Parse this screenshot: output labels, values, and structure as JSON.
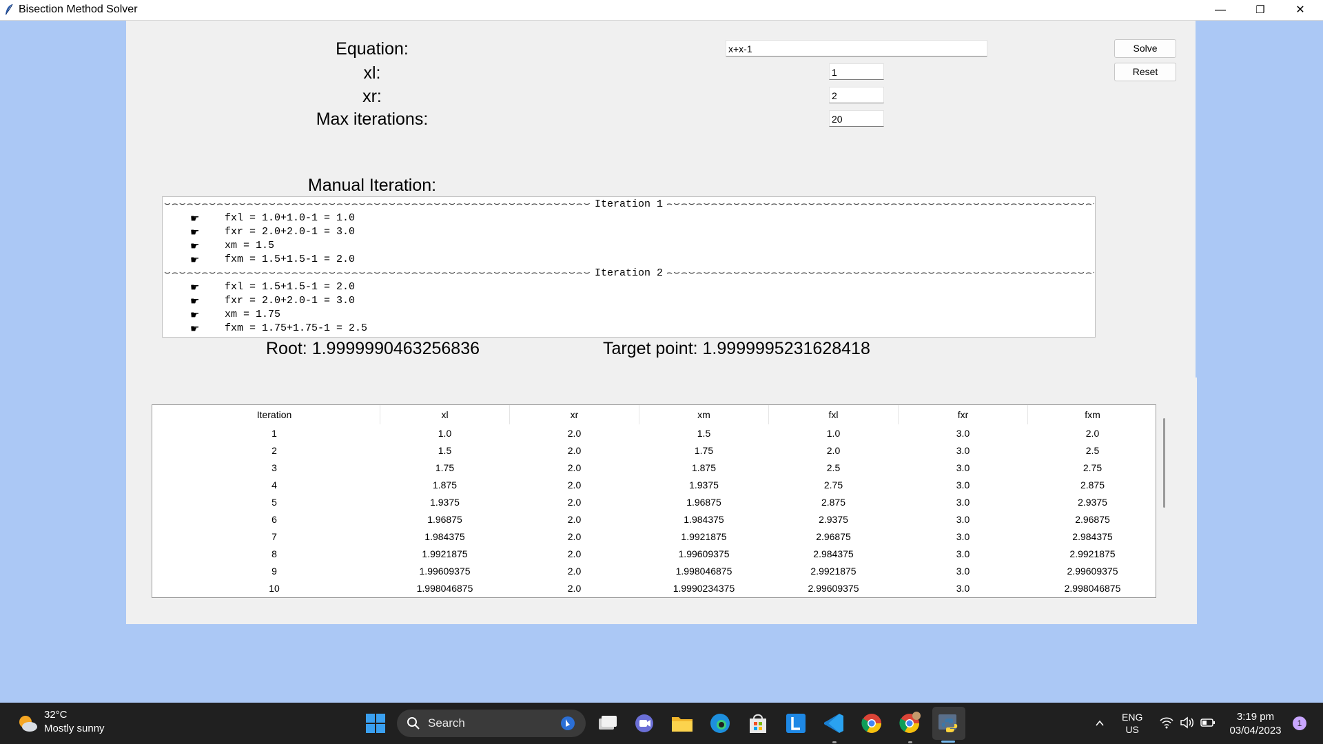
{
  "window": {
    "title": "Bisection Method Solver",
    "minimize": "—",
    "maximize": "❐",
    "close": "✕"
  },
  "form": {
    "equation_label": "Equation:",
    "equation_value": "x+x-1",
    "xl_label": "xl:",
    "xl_value": "1",
    "xr_label": "xr:",
    "xr_value": "2",
    "maxiter_label": "Max iterations:",
    "maxiter_value": "20",
    "solve_label": "Solve",
    "reset_label": "Reset"
  },
  "manual": {
    "label": "Manual Iteration:",
    "iterations": [
      {
        "header": "Iteration 1",
        "lines": [
          "fxl = 1.0+1.0-1 = 1.0",
          "fxr = 2.0+2.0-1 = 3.0",
          "xm = 1.5",
          "fxm = 1.5+1.5-1 = 2.0"
        ]
      },
      {
        "header": "Iteration 2",
        "lines": [
          "fxl = 1.5+1.5-1 = 2.0",
          "fxr = 2.0+2.0-1 = 3.0",
          "xm = 1.75",
          "fxm = 1.75+1.75-1 = 2.5"
        ]
      }
    ]
  },
  "results": {
    "root": "Root: 1.9999990463256836",
    "target": "Target point: 1.9999995231628418"
  },
  "table": {
    "columns": [
      "Iteration",
      "xl",
      "xr",
      "xm",
      "fxl",
      "fxr",
      "fxm"
    ],
    "rows": [
      [
        "1",
        "1.0",
        "2.0",
        "1.5",
        "1.0",
        "3.0",
        "2.0"
      ],
      [
        "2",
        "1.5",
        "2.0",
        "1.75",
        "2.0",
        "3.0",
        "2.5"
      ],
      [
        "3",
        "1.75",
        "2.0",
        "1.875",
        "2.5",
        "3.0",
        "2.75"
      ],
      [
        "4",
        "1.875",
        "2.0",
        "1.9375",
        "2.75",
        "3.0",
        "2.875"
      ],
      [
        "5",
        "1.9375",
        "2.0",
        "1.96875",
        "2.875",
        "3.0",
        "2.9375"
      ],
      [
        "6",
        "1.96875",
        "2.0",
        "1.984375",
        "2.9375",
        "3.0",
        "2.96875"
      ],
      [
        "7",
        "1.984375",
        "2.0",
        "1.9921875",
        "2.96875",
        "3.0",
        "2.984375"
      ],
      [
        "8",
        "1.9921875",
        "2.0",
        "1.99609375",
        "2.984375",
        "3.0",
        "2.9921875"
      ],
      [
        "9",
        "1.99609375",
        "2.0",
        "1.998046875",
        "2.9921875",
        "3.0",
        "2.99609375"
      ],
      [
        "10",
        "1.998046875",
        "2.0",
        "1.9990234375",
        "2.99609375",
        "3.0",
        "2.998046875"
      ]
    ]
  },
  "taskbar": {
    "temperature": "32°C",
    "weather": "Mostly sunny",
    "search_label": "Search",
    "lang": "ENG",
    "region": "US",
    "time": "3:19 pm",
    "date": "03/04/2023",
    "notification_count": "1",
    "apps": [
      "windows-start-icon",
      "task-view-icon",
      "teams-chat-icon",
      "file-explorer-icon",
      "edge-icon",
      "store-icon",
      "l-app-icon",
      "vscode-icon",
      "chrome-icon",
      "chrome-profile-icon",
      "python-icon"
    ]
  }
}
